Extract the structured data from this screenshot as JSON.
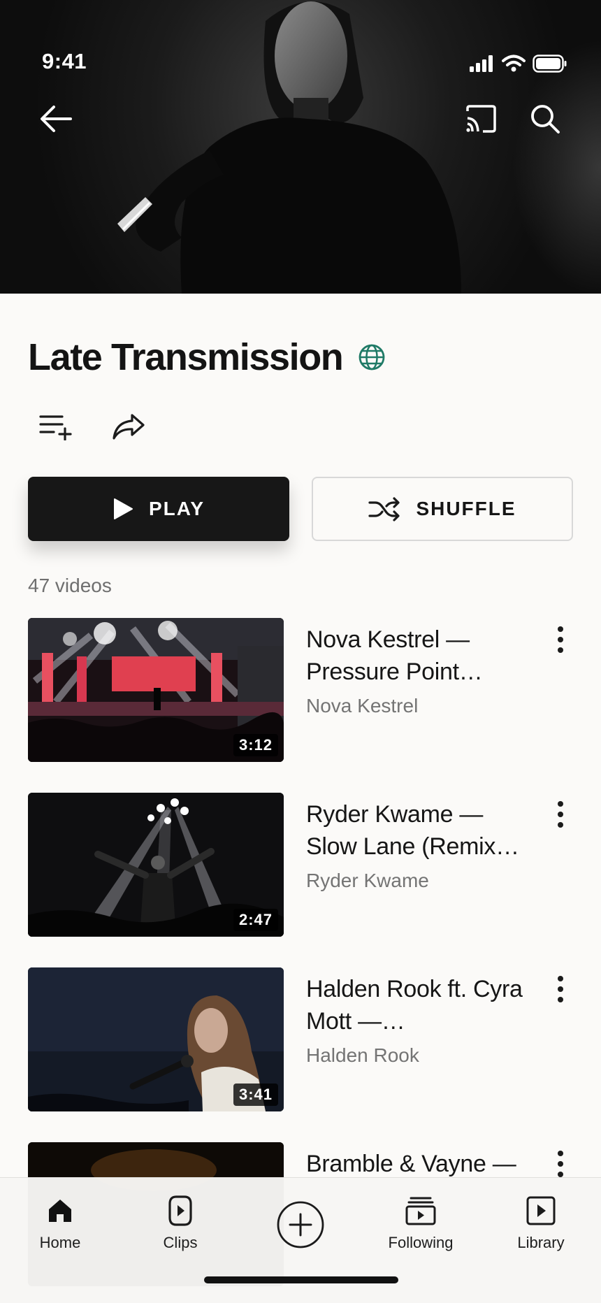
{
  "status_bar": {
    "time": "9:41"
  },
  "header_icons": [
    "back-arrow-icon",
    "cast-icon",
    "search-icon"
  ],
  "playlist": {
    "title": "Late Transmission",
    "visibility_icon": "globe-icon",
    "actions": [
      "add-to-queue-icon",
      "share-icon"
    ],
    "play_label": "PLAY",
    "shuffle_label": "SHUFFLE",
    "count_text": "47 videos"
  },
  "videos": [
    {
      "title": "Nova Kestrel — Pressure Point…",
      "channel": "Nova Kestrel",
      "duration": "3:12"
    },
    {
      "title": "Ryder Kwame — Slow Lane (Remix…",
      "channel": "Ryder Kwame",
      "duration": "2:47"
    },
    {
      "title": "Halden Rook ft. Cyra Mott —…",
      "channel": "Halden Rook",
      "duration": "3:41"
    },
    {
      "title": "Bramble & Vayne —",
      "channel": "",
      "duration": ""
    }
  ],
  "nav": {
    "items": [
      {
        "label": "Home",
        "icon": "home-icon",
        "active": true
      },
      {
        "label": "Clips",
        "icon": "clips-icon"
      },
      {
        "label": "",
        "icon": "create-icon"
      },
      {
        "label": "Following",
        "icon": "subscriptions-icon"
      },
      {
        "label": "Library",
        "icon": "library-icon"
      }
    ]
  },
  "colors": {
    "accent_globe": "#1f7a66",
    "play_bg": "#171717",
    "background": "#fbfaf8"
  }
}
